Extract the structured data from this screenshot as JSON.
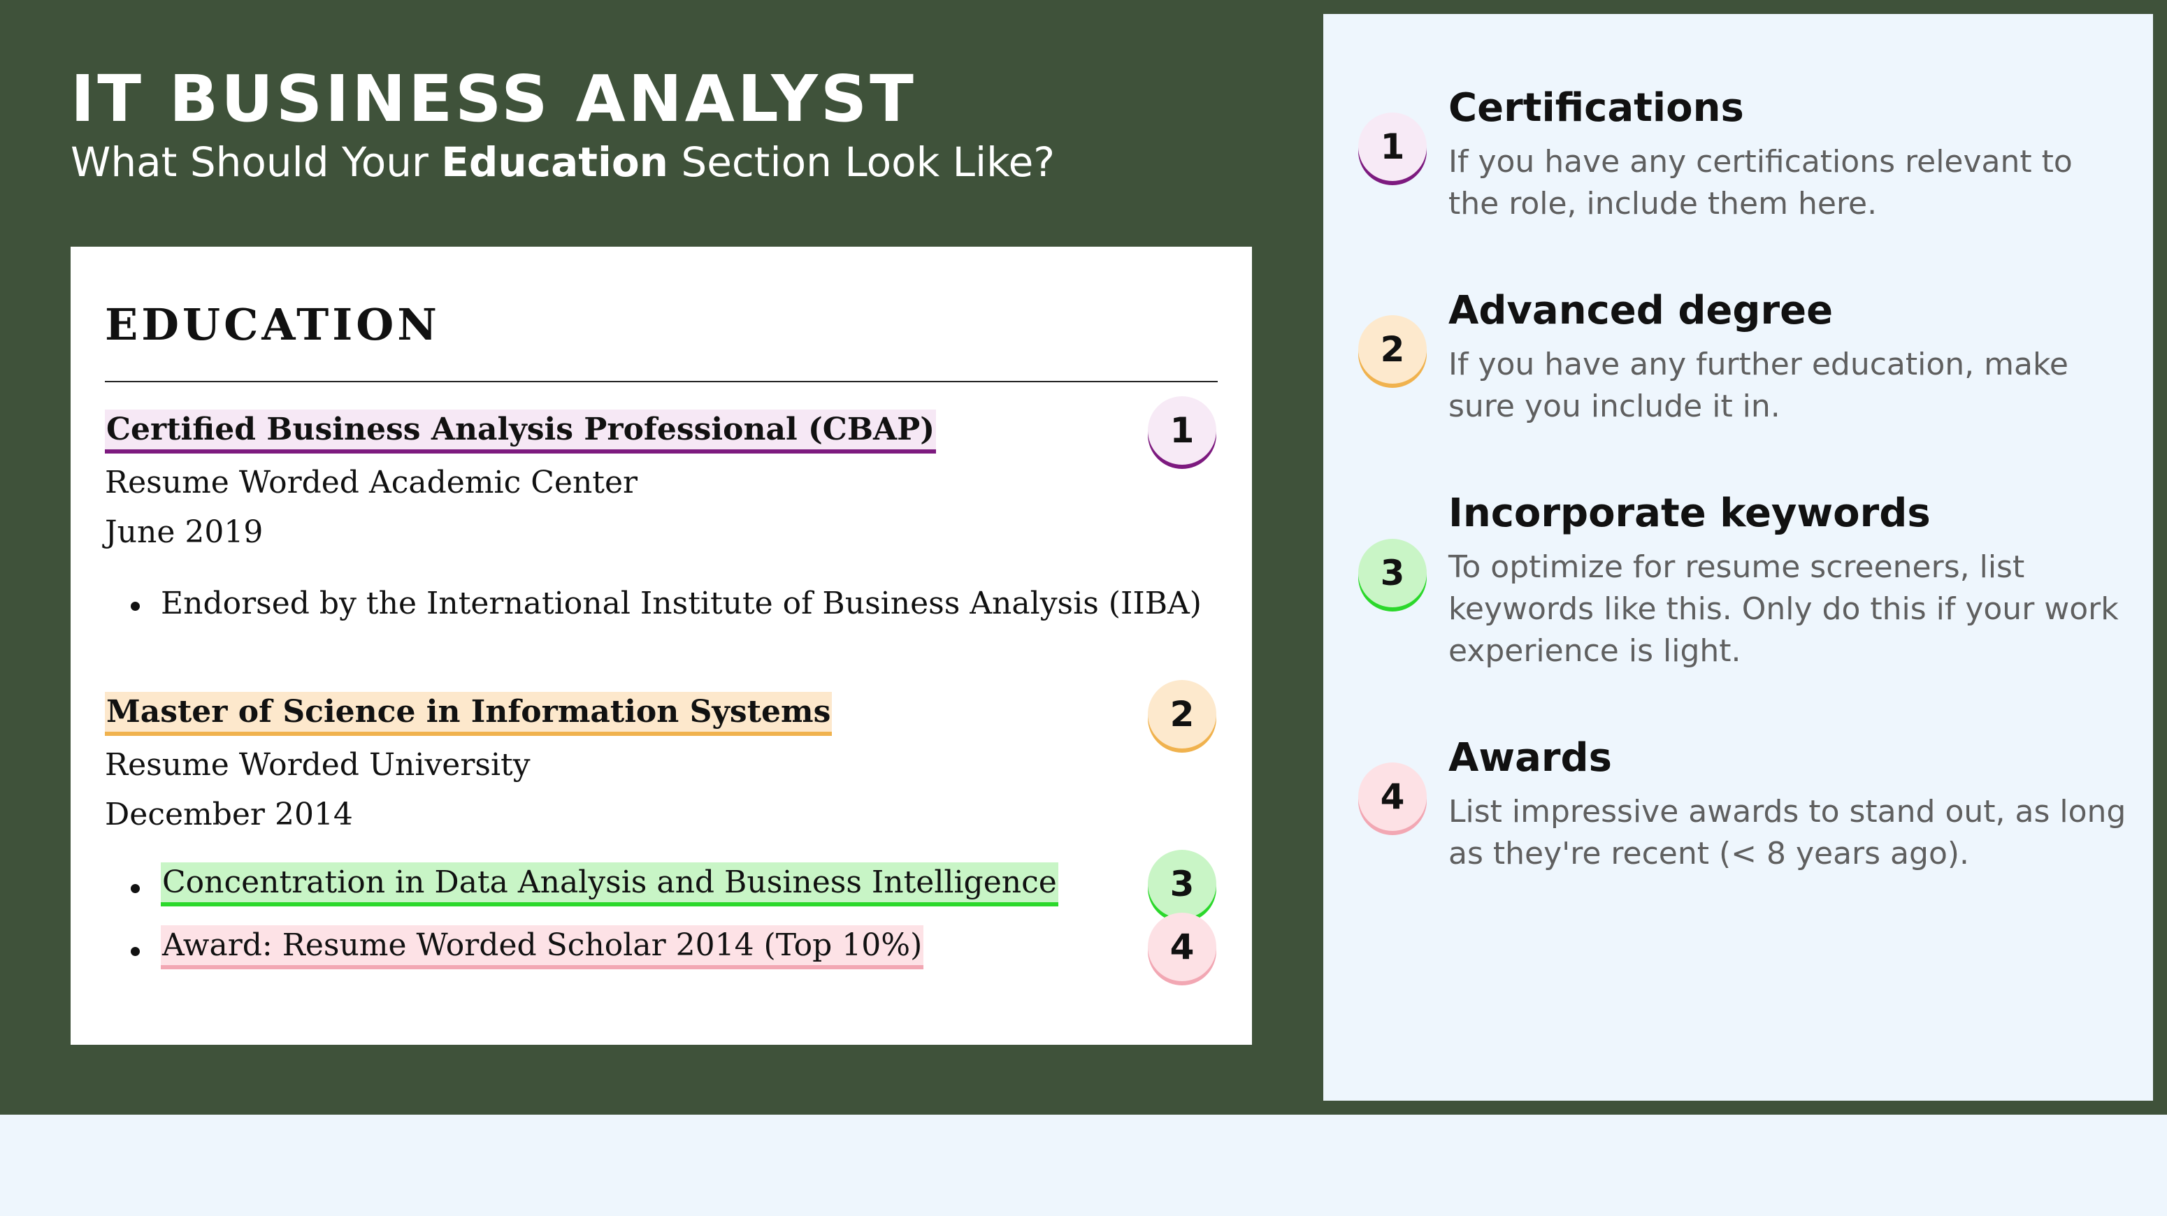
{
  "header": {
    "title": "IT BUSINESS ANALYST",
    "subtitle_before": "What Should Your ",
    "subtitle_bold": "Education",
    "subtitle_after": " Section Look Like?"
  },
  "resume": {
    "heading": "EDUCATION",
    "entries": [
      {
        "title": "Certified Business Analysis Professional (CBAP)",
        "institution": "Resume Worded Academic Center",
        "date": "June 2019",
        "bullets": [
          "Endorsed by the International Institute of Business Analysis (IIBA)"
        ],
        "badge": "1"
      },
      {
        "title": "Master of Science in Information Systems",
        "institution": "Resume Worded University",
        "date": "December 2014",
        "bullets": [
          "Concentration in Data Analysis and Business Intelligence",
          "Award: Resume Worded Scholar 2014 (Top 10%)"
        ],
        "badge": "2"
      }
    ],
    "bullet_badges": [
      "3",
      "4"
    ]
  },
  "tips": [
    {
      "number": "1",
      "title": "Certifications",
      "text": "If you have any certifications relevant to the role, include them here.",
      "accent": "#7d1a7f"
    },
    {
      "number": "2",
      "title": "Advanced degree",
      "text": "If you have any further education, make sure you include it in.",
      "accent": "#f0b24e"
    },
    {
      "number": "3",
      "title": "Incorporate keywords",
      "text": "To optimize for resume screeners, list keywords like this. Only do this if your work experience is light.",
      "accent": "#2bd82b"
    },
    {
      "number": "4",
      "title": "Awards",
      "text": "List impressive awards to stand out, as long as they're recent (< 8 years ago).",
      "accent": "#f2a7b3"
    }
  ],
  "colors": {
    "background_green": "#3f523a",
    "panel_blue": "#eef6fd"
  }
}
